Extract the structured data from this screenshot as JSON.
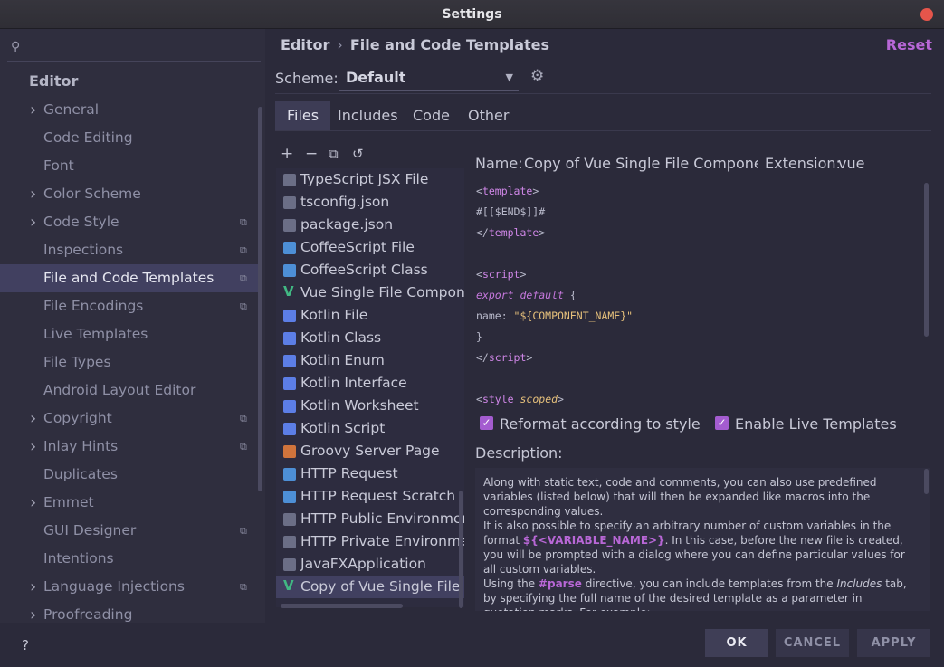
{
  "window": {
    "title": "Settings"
  },
  "sidebar": {
    "search_placeholder": "",
    "section_title": "Editor",
    "items": [
      {
        "label": "General",
        "expandable": true,
        "project": false,
        "selected": false
      },
      {
        "label": "Code Editing",
        "expandable": false,
        "project": false,
        "selected": false
      },
      {
        "label": "Font",
        "expandable": false,
        "project": false,
        "selected": false
      },
      {
        "label": "Color Scheme",
        "expandable": true,
        "project": false,
        "selected": false
      },
      {
        "label": "Code Style",
        "expandable": true,
        "project": true,
        "selected": false
      },
      {
        "label": "Inspections",
        "expandable": false,
        "project": true,
        "selected": false
      },
      {
        "label": "File and Code Templates",
        "expandable": false,
        "project": true,
        "selected": true
      },
      {
        "label": "File Encodings",
        "expandable": false,
        "project": true,
        "selected": false
      },
      {
        "label": "Live Templates",
        "expandable": false,
        "project": false,
        "selected": false
      },
      {
        "label": "File Types",
        "expandable": false,
        "project": false,
        "selected": false
      },
      {
        "label": "Android Layout Editor",
        "expandable": false,
        "project": false,
        "selected": false
      },
      {
        "label": "Copyright",
        "expandable": true,
        "project": true,
        "selected": false
      },
      {
        "label": "Inlay Hints",
        "expandable": true,
        "project": true,
        "selected": false
      },
      {
        "label": "Duplicates",
        "expandable": false,
        "project": false,
        "selected": false
      },
      {
        "label": "Emmet",
        "expandable": true,
        "project": false,
        "selected": false
      },
      {
        "label": "GUI Designer",
        "expandable": false,
        "project": true,
        "selected": false
      },
      {
        "label": "Intentions",
        "expandable": false,
        "project": false,
        "selected": false
      },
      {
        "label": "Language Injections",
        "expandable": true,
        "project": true,
        "selected": false
      },
      {
        "label": "Proofreading",
        "expandable": true,
        "project": false,
        "selected": false
      }
    ]
  },
  "breadcrumb": {
    "parent": "Editor",
    "current": "File and Code Templates",
    "separator": "›"
  },
  "reset_label": "Reset",
  "scheme": {
    "label": "Scheme:",
    "value": "Default"
  },
  "tabs": [
    {
      "label": "Files",
      "active": true
    },
    {
      "label": "Includes",
      "active": false
    },
    {
      "label": "Code",
      "active": false
    },
    {
      "label": "Other",
      "active": false
    }
  ],
  "toolbar": {
    "add": "+",
    "remove": "−",
    "copy": "⧉",
    "revert": "↺"
  },
  "templates": [
    {
      "label": "TypeScript JSX File",
      "icon": "tsx-file-icon",
      "color": "#6b6e86",
      "selected": false
    },
    {
      "label": "tsconfig.json",
      "icon": "json-file-icon",
      "color": "#6b6e86",
      "selected": false
    },
    {
      "label": "package.json",
      "icon": "json-file-icon",
      "color": "#6b6e86",
      "selected": false
    },
    {
      "label": "CoffeeScript File",
      "icon": "coffeescript-icon",
      "color": "#4d8fd6",
      "selected": false
    },
    {
      "label": "CoffeeScript Class",
      "icon": "coffeescript-icon",
      "color": "#4d8fd6",
      "selected": false
    },
    {
      "label": "Vue Single File Component",
      "icon": "vue-icon",
      "color": "#41b883",
      "selected": false
    },
    {
      "label": "Kotlin File",
      "icon": "kotlin-icon",
      "color": "#5c7ee6",
      "selected": false
    },
    {
      "label": "Kotlin Class",
      "icon": "kotlin-icon",
      "color": "#5c7ee6",
      "selected": false
    },
    {
      "label": "Kotlin Enum",
      "icon": "kotlin-icon",
      "color": "#5c7ee6",
      "selected": false
    },
    {
      "label": "Kotlin Interface",
      "icon": "kotlin-icon",
      "color": "#5c7ee6",
      "selected": false
    },
    {
      "label": "Kotlin Worksheet",
      "icon": "kotlin-icon",
      "color": "#5c7ee6",
      "selected": false
    },
    {
      "label": "Kotlin Script",
      "icon": "kotlin-icon",
      "color": "#5c7ee6",
      "selected": false
    },
    {
      "label": "Groovy Server Page",
      "icon": "gsp-icon",
      "color": "#d0743c",
      "selected": false
    },
    {
      "label": "HTTP Request",
      "icon": "api-icon",
      "color": "#4d8fd6",
      "selected": false
    },
    {
      "label": "HTTP Request Scratch",
      "icon": "api-icon",
      "color": "#4d8fd6",
      "selected": false
    },
    {
      "label": "HTTP Public Environment File",
      "icon": "json-file-icon",
      "color": "#6b6e86",
      "selected": false
    },
    {
      "label": "HTTP Private Environment File",
      "icon": "json-file-icon",
      "color": "#6b6e86",
      "selected": false
    },
    {
      "label": "JavaFXApplication",
      "icon": "java-file-icon",
      "color": "#6b6e86",
      "selected": false
    },
    {
      "label": "Copy of Vue Single File Component",
      "icon": "vue-icon",
      "color": "#41b883",
      "selected": true
    }
  ],
  "form": {
    "name_label": "Name:",
    "name_value": "Copy of Vue Single File Component",
    "extension_label": "Extension:",
    "extension_value": "vue"
  },
  "code": {
    "template_open": "template",
    "end_macro": "#[[$END$]]#",
    "template_close": "template",
    "script_open": "script",
    "export_kw": "export default",
    "brace_open": " {",
    "name_key": "name: ",
    "name_val": "\"${COMPONENT_NAME}\"",
    "brace_close": "}",
    "script_close": "script",
    "style_tag": "style",
    "style_attr": "scoped"
  },
  "options": {
    "reformat_label": "Reformat according to style",
    "reformat_checked": true,
    "live_templates_label": "Enable Live Templates",
    "live_templates_checked": true
  },
  "description": {
    "title": "Description:",
    "p1": "Along with static text, code and comments, you can also use predefined variables (listed below) that will then be expanded like macros into the corresponding values.",
    "p2a": "It is also possible to specify an arbitrary number of custom variables in the format ",
    "p2var": "${<VARIABLE_NAME>}",
    "p2b": ". In this case, before the new file is created, you will be prompted with a dialog where you can define particular values for all custom variables.",
    "p3a": "Using the ",
    "p3kw": "#parse",
    "p3b": " directive, you can include templates from the ",
    "p3tab": "Includes",
    "p3c": " tab, by specifying the full name of the desired template as a parameter in quotation marks. For example:"
  },
  "footer": {
    "help": "?",
    "ok": "OK",
    "cancel": "CANCEL",
    "apply": "APPLY"
  }
}
